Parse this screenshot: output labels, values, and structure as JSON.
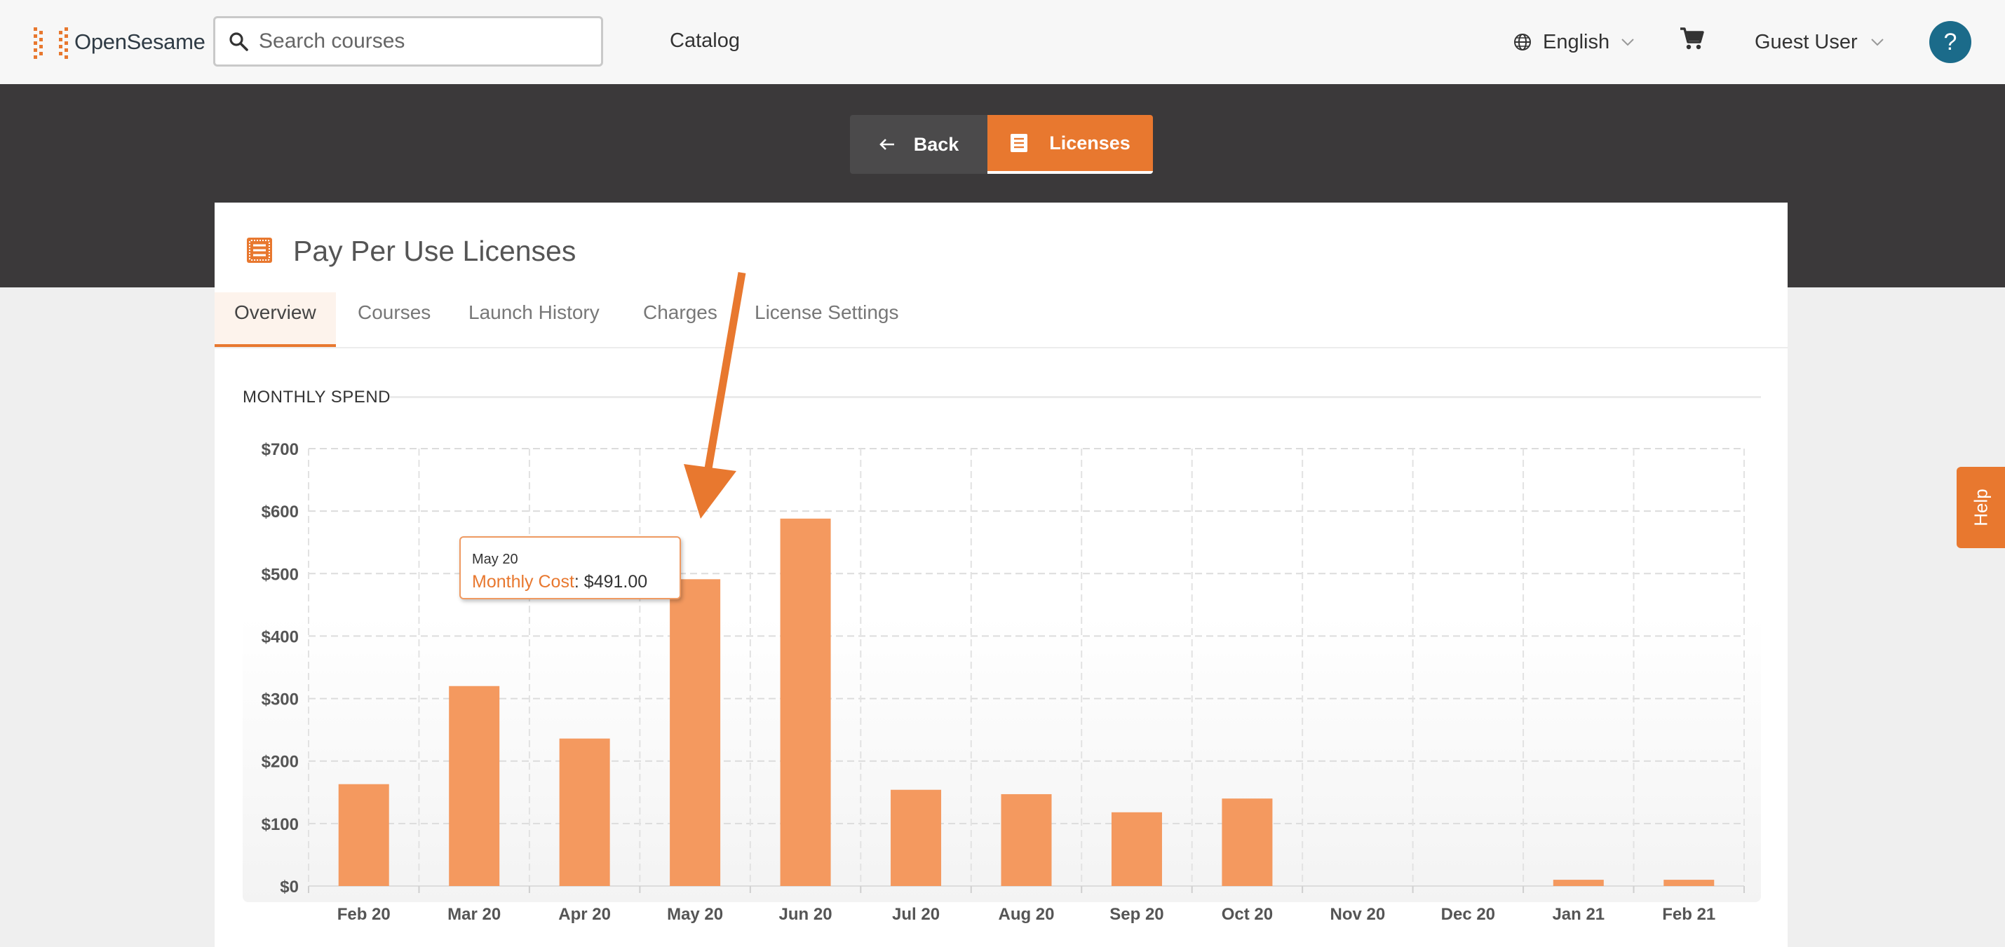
{
  "header": {
    "logo_text": "OpenSesame",
    "search_placeholder": "Search courses",
    "catalog_label": "Catalog",
    "language_label": "English",
    "user_label": "Guest User",
    "help_circle_label": "?"
  },
  "toolbar": {
    "back_label": "Back",
    "licenses_label": "Licenses"
  },
  "card": {
    "title": "Pay Per Use Licenses",
    "tabs": [
      {
        "label": "Overview",
        "active": true
      },
      {
        "label": "Courses",
        "active": false
      },
      {
        "label": "Launch History",
        "active": false
      },
      {
        "label": "Charges",
        "active": false
      },
      {
        "label": "License Settings",
        "active": false
      }
    ],
    "section_label": "MONTHLY SPEND"
  },
  "tooltip": {
    "date": "May 20",
    "series_label": "Monthly Cost",
    "value": "$491.00"
  },
  "help_tab_label": "Help",
  "colors": {
    "brand_orange": "#e8782f",
    "bar_orange": "#f4995f",
    "help_blue": "#1b6b8a",
    "dark_band": "#3b393a"
  },
  "chart_data": {
    "type": "bar",
    "categories": [
      "Feb 20",
      "Mar 20",
      "Apr 20",
      "May 20",
      "Jun 20",
      "Jul 20",
      "Aug 20",
      "Sep 20",
      "Oct 20",
      "Nov 20",
      "Dec 20",
      "Jan 21",
      "Feb 21"
    ],
    "series": [
      {
        "name": "Monthly Cost",
        "values": [
          163,
          320,
          236,
          491,
          588,
          154,
          147,
          118,
          140,
          0,
          0,
          10,
          10
        ]
      }
    ],
    "ylim": [
      0,
      700
    ],
    "yticks": [
      "$0",
      "$100",
      "$200",
      "$300",
      "$400",
      "$500",
      "$600",
      "$700"
    ],
    "grid": true,
    "highlighted_category": "May 20"
  }
}
